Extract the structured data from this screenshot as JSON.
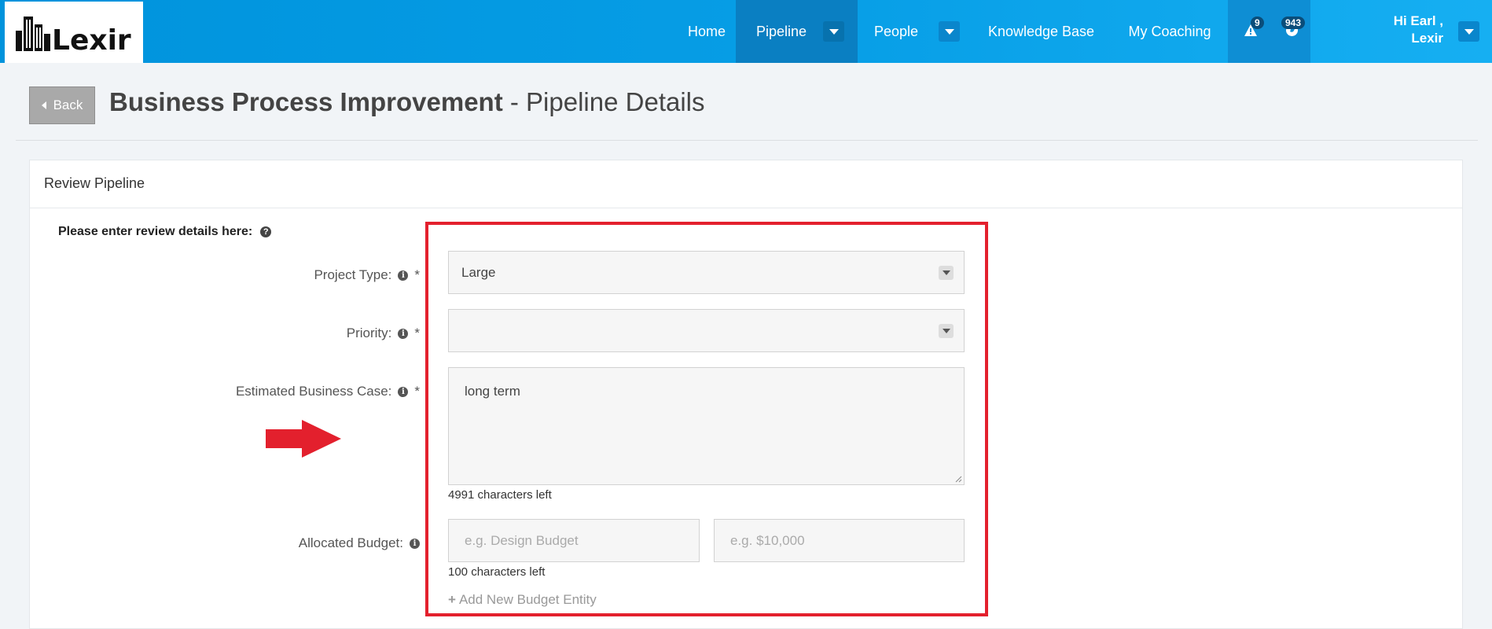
{
  "brand": {
    "name": "Lexir"
  },
  "nav": {
    "items": [
      {
        "label": "Home"
      },
      {
        "label": "Pipeline"
      },
      {
        "label": "People"
      },
      {
        "label": "Knowledge Base"
      },
      {
        "label": "My Coaching"
      }
    ],
    "alerts_count": "9",
    "messages_count": "943",
    "user_greeting_line1": "Hi Earl ,",
    "user_greeting_line2": "Lexir"
  },
  "header": {
    "back_label": "Back",
    "title_strong": "Business Process Improvement",
    "title_rest": " - Pipeline Details"
  },
  "panel": {
    "heading": "Review Pipeline",
    "section_label": "Please enter review details here:"
  },
  "form": {
    "project_type": {
      "label": "Project Type:",
      "value": "Large"
    },
    "priority": {
      "label": "Priority:",
      "value": ""
    },
    "business_case": {
      "label": "Estimated Business Case:",
      "value": "long term",
      "chars_left": "4991 characters left"
    },
    "budget": {
      "label": "Allocated Budget:",
      "name_placeholder": "e.g. Design Budget",
      "amount_placeholder": "e.g. $10,000",
      "chars_left": "100 characters left",
      "add_label": "Add New Budget Entity"
    },
    "required_mark": "*"
  },
  "colors": {
    "nav_blue": "#0093dc",
    "nav_active": "#0a7fc2",
    "annotation_red": "#e3202d"
  },
  "icons": [
    "warning-icon",
    "globe-icon",
    "info-icon",
    "question-icon",
    "plus-icon",
    "caret-down-icon",
    "caret-left-icon"
  ]
}
